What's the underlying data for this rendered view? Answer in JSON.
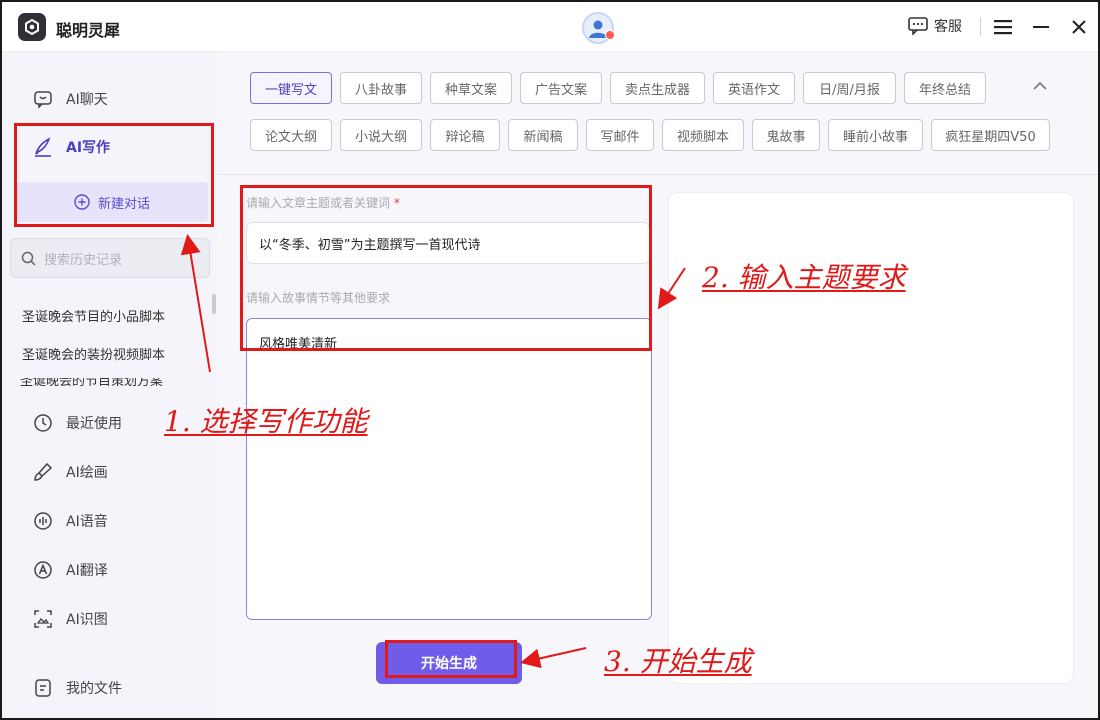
{
  "app": {
    "title": "聪明灵犀",
    "support_label": "客服"
  },
  "sidebar": {
    "chat_label": "AI聊天",
    "write_label": "AI写作",
    "new_chat_label": "新建对话",
    "search_placeholder": "搜索历史记录",
    "history": [
      "圣诞晚会节目的小品脚本",
      "圣诞晚会的装扮视频脚本",
      "圣诞晚会的节目策划方案"
    ],
    "bottom_nav": [
      {
        "label": "最近使用",
        "icon": "clock-icon"
      },
      {
        "label": "AI绘画",
        "icon": "brush-icon"
      },
      {
        "label": "AI语音",
        "icon": "voice-icon"
      },
      {
        "label": "AI翻译",
        "icon": "translate-icon"
      },
      {
        "label": "AI识图",
        "icon": "image-scan-icon"
      }
    ],
    "files_label": "我的文件"
  },
  "categories": {
    "row1": [
      "一键写文",
      "八卦故事",
      "种草文案",
      "广告文案",
      "卖点生成器",
      "英语作文",
      "日/周/月报",
      "年终总结"
    ],
    "row2": [
      "论文大纲",
      "小说大纲",
      "辩论稿",
      "新闻稿",
      "写邮件",
      "视频脚本",
      "鬼故事",
      "睡前小故事",
      "疯狂星期四V50"
    ],
    "active": "一键写文"
  },
  "form": {
    "topic_label": "请输入文章主题或者关键词",
    "required_mark": "*",
    "topic_value": "以“冬季、初雪”为主题撰写一首现代诗",
    "details_label": "请输入故事情节等其他要求",
    "details_value": "风格唯美清新",
    "generate_label": "开始生成"
  },
  "annotations": {
    "step1": "1. 选择写作功能",
    "step2": "2. 输入主题要求",
    "step3": "3. 开始生成",
    "color": "#e01919"
  },
  "colors": {
    "accent": "#6f5ce8",
    "active_text": "#4b3fbf",
    "new_chat_bg": "#e6e3fb"
  }
}
